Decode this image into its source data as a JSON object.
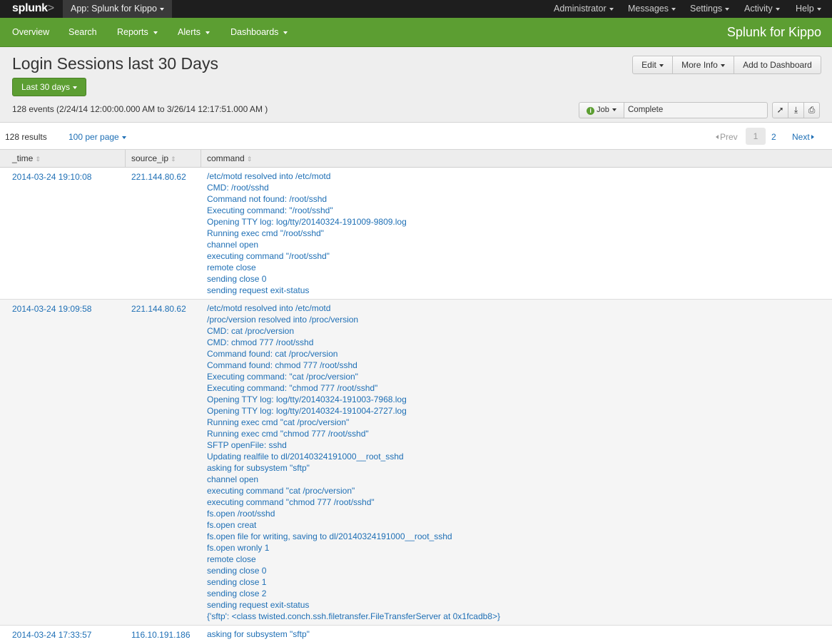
{
  "topbar": {
    "logo": "splunk",
    "logo_suffix": ">",
    "app_menu": "App: Splunk for Kippo",
    "nav": [
      "Administrator",
      "Messages",
      "Settings",
      "Activity",
      "Help"
    ]
  },
  "appbar": {
    "nav": [
      "Overview",
      "Search",
      "Reports",
      "Alerts",
      "Dashboards"
    ],
    "title": "Splunk for Kippo"
  },
  "header": {
    "title": "Login Sessions last 30 Days",
    "time_range": "Last 30 days",
    "events_summary": "128 events (2/24/14 12:00:00.000 AM to 3/26/14 12:17:51.000 AM )",
    "edit": "Edit",
    "more_info": "More Info",
    "add_to_dashboard": "Add to Dashboard",
    "job": "Job",
    "job_status": "Complete"
  },
  "results": {
    "count": "128 results",
    "per_page": "100 per page",
    "prev": "Prev",
    "page1": "1",
    "page2": "2",
    "next": "Next"
  },
  "table": {
    "columns": [
      "_time",
      "source_ip",
      "command"
    ],
    "rows": [
      {
        "time": "2014-03-24 19:10:08",
        "ip": "221.144.80.62",
        "commands": [
          "/etc/motd resolved into /etc/motd",
          "CMD: /root/sshd",
          "Command not found: /root/sshd",
          "Executing command: \"/root/sshd\"",
          "Opening TTY log: log/tty/20140324-191009-9809.log",
          "Running exec cmd \"/root/sshd\"",
          "channel open",
          "executing command \"/root/sshd\"",
          "remote close",
          "sending close 0",
          "sending request exit-status"
        ]
      },
      {
        "time": "2014-03-24 19:09:58",
        "ip": "221.144.80.62",
        "commands": [
          "/etc/motd resolved into /etc/motd",
          "/proc/version resolved into /proc/version",
          "CMD: cat /proc/version",
          "CMD: chmod 777 /root/sshd",
          "Command found: cat /proc/version",
          "Command found: chmod 777 /root/sshd",
          "Executing command: \"cat /proc/version\"",
          "Executing command: \"chmod 777 /root/sshd\"",
          "Opening TTY log: log/tty/20140324-191003-7968.log",
          "Opening TTY log: log/tty/20140324-191004-2727.log",
          "Running exec cmd \"cat /proc/version\"",
          "Running exec cmd \"chmod 777 /root/sshd\"",
          "SFTP openFile: sshd",
          "Updating realfile to dl/20140324191000__root_sshd",
          "asking for subsystem \"sftp\"",
          "channel open",
          "executing command \"cat /proc/version\"",
          "executing command \"chmod 777 /root/sshd\"",
          "fs.open /root/sshd",
          "fs.open creat",
          "fs.open file for writing, saving to dl/20140324191000__root_sshd",
          "fs.open wronly 1",
          "remote close",
          "sending close 0",
          "sending close 1",
          "sending close 2",
          "sending request exit-status",
          "{'sftp': <class twisted.conch.ssh.filetransfer.FileTransferServer at 0x1fcadb8>}"
        ]
      },
      {
        "time": "2014-03-24 17:33:57",
        "ip": "116.10.191.186",
        "commands": [
          "asking for subsystem \"sftp\""
        ]
      }
    ]
  }
}
